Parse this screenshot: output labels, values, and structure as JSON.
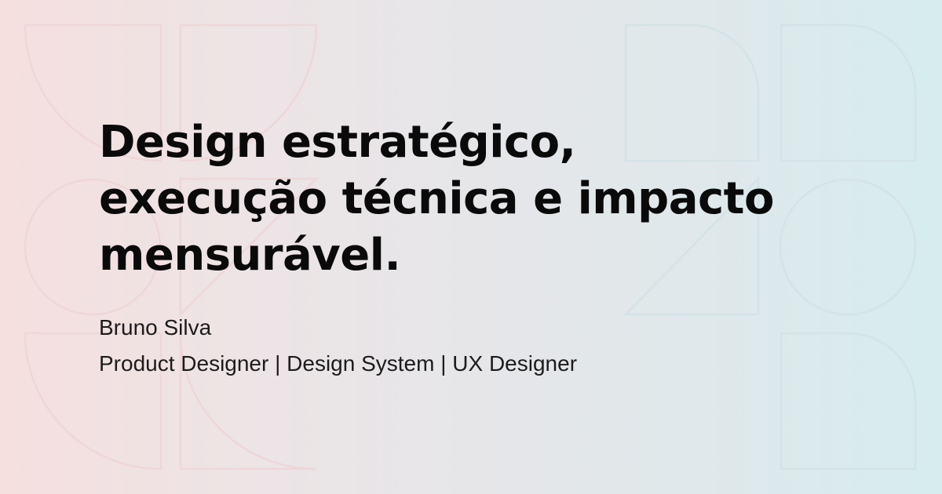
{
  "headline": {
    "lines": [
      "Design estratégico,",
      "execução técnica e impacto",
      "mensurável."
    ]
  },
  "author": {
    "name": "Bruno Silva",
    "roles": "Product Designer | Design System | UX Designer"
  },
  "colors": {
    "gradient_start": "#f6dfdf",
    "gradient_end": "#d6ecee",
    "text": "#0a0a0a",
    "shape_stroke_left": "#efd6d8",
    "shape_stroke_right": "#d3e3e6"
  }
}
